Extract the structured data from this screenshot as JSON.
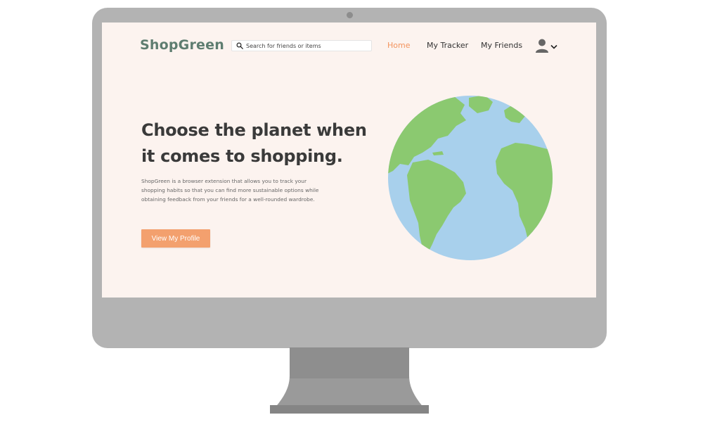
{
  "brand": {
    "name": "ShopGreen"
  },
  "search": {
    "placeholder": "Search for friends or items",
    "value": ""
  },
  "nav": {
    "items": [
      {
        "label": "Home",
        "active": true
      },
      {
        "label": "My Tracker",
        "active": false
      },
      {
        "label": "My Friends",
        "active": false
      }
    ],
    "profile_icon": "user-icon",
    "dropdown_icon": "chevron-down-icon"
  },
  "hero": {
    "title_lines": [
      "Choose the planet when",
      "it comes to shopping."
    ],
    "description_lines": [
      "ShopGreen is a browser extension that allows you to track your",
      "shopping habits so that you can find more sustainable options while",
      "obtaining feedback from your friends for a well-rounded wardrobe."
    ],
    "cta_label": "View My Profile"
  },
  "colors": {
    "brand": "#5e7d70",
    "accent": "#f3935d",
    "button": "#f3a06e",
    "background": "#fcf3ef",
    "ocean": "#a8d0ec",
    "land": "#8bc970"
  }
}
